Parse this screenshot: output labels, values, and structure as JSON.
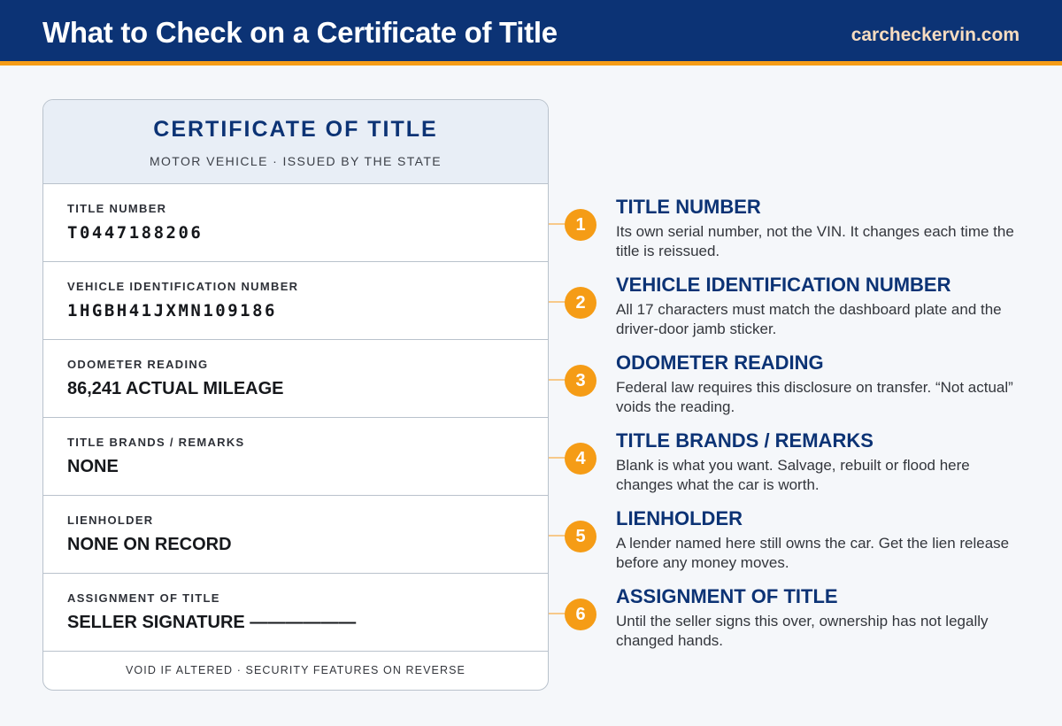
{
  "header": {
    "title": "What to Check on a Certificate of Title",
    "brand": "carcheckervin.com"
  },
  "certificate": {
    "title": "CERTIFICATE OF TITLE",
    "subtitle": "MOTOR VEHICLE · ISSUED BY THE STATE",
    "fields": [
      {
        "label": "TITLE NUMBER",
        "value": "T0447188206"
      },
      {
        "label": "VEHICLE IDENTIFICATION NUMBER",
        "value": "1HGBH41JXMN109186"
      },
      {
        "label": "ODOMETER READING",
        "value": "86,241 ACTUAL MILEAGE"
      },
      {
        "label": "TITLE BRANDS / REMARKS",
        "value": "NONE"
      },
      {
        "label": "LIENHOLDER",
        "value": "NONE ON RECORD"
      },
      {
        "label": "ASSIGNMENT OF TITLE",
        "value": "SELLER SIGNATURE ——————"
      }
    ],
    "footer": "VOID IF ALTERED · SECURITY FEATURES ON REVERSE"
  },
  "callouts": [
    {
      "number": "1",
      "title": "TITLE NUMBER",
      "description": "Its own serial number, not the VIN. It changes each time the title is reissued."
    },
    {
      "number": "2",
      "title": "VEHICLE IDENTIFICATION NUMBER",
      "description": "All 17 characters must match the dashboard plate and the driver-door jamb sticker."
    },
    {
      "number": "3",
      "title": "ODOMETER READING",
      "description": "Federal law requires this disclosure on transfer. “Not actual” voids the reading."
    },
    {
      "number": "4",
      "title": "TITLE BRANDS / REMARKS",
      "description": "Blank is what you want. Salvage, rebuilt or flood here changes what the car is worth."
    },
    {
      "number": "5",
      "title": "LIENHOLDER",
      "description": "A lender named here still owns the car. Get the lien release before any money moves."
    },
    {
      "number": "6",
      "title": "ASSIGNMENT OF TITLE",
      "description": "Until the seller signs this over, ownership has not legally changed hands."
    }
  ],
  "colors": {
    "navy": "#0c3375",
    "accent_orange": "#f59c16",
    "card_header_bg": "#e8eef6",
    "brand_text": "#f7dcc0"
  }
}
